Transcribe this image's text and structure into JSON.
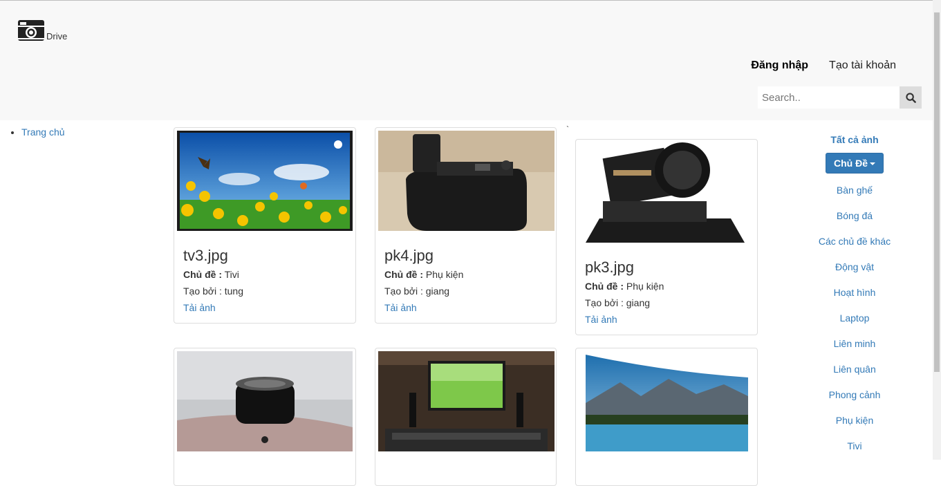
{
  "header": {
    "brand_text": "Drive",
    "login": "Đăng nhập",
    "register": "Tạo tài khoản",
    "search_placeholder": "Search.."
  },
  "left_nav": {
    "items": [
      {
        "label": "Trang chủ"
      }
    ]
  },
  "stray_mark": "`",
  "cards": [
    {
      "filename": "tv3.jpg",
      "topic_label": "Chủ đề :",
      "topic": "Tivi",
      "creator": "Tạo bởi : tung",
      "download": "Tải ảnh"
    },
    {
      "filename": "pk4.jpg",
      "topic_label": "Chủ đề :",
      "topic": "Phụ kiện",
      "creator": "Tạo bởi : giang",
      "download": "Tải ảnh"
    },
    {
      "filename": "pk3.jpg",
      "topic_label": "Chủ đề :",
      "topic": "Phụ kiện",
      "creator": "Tạo bởi : giang",
      "download": "Tải ảnh"
    }
  ],
  "right_nav": {
    "all_photos": "Tất cả ảnh",
    "dropdown_label": "Chủ Đề",
    "topics": [
      "Bàn ghế",
      "Bóng đá",
      "Các chủ đề khác",
      "Động vật",
      "Hoạt hình",
      "Laptop",
      "Liên minh",
      "Liên quân",
      "Phong cảnh",
      "Phụ kiện",
      "Tivi"
    ]
  }
}
